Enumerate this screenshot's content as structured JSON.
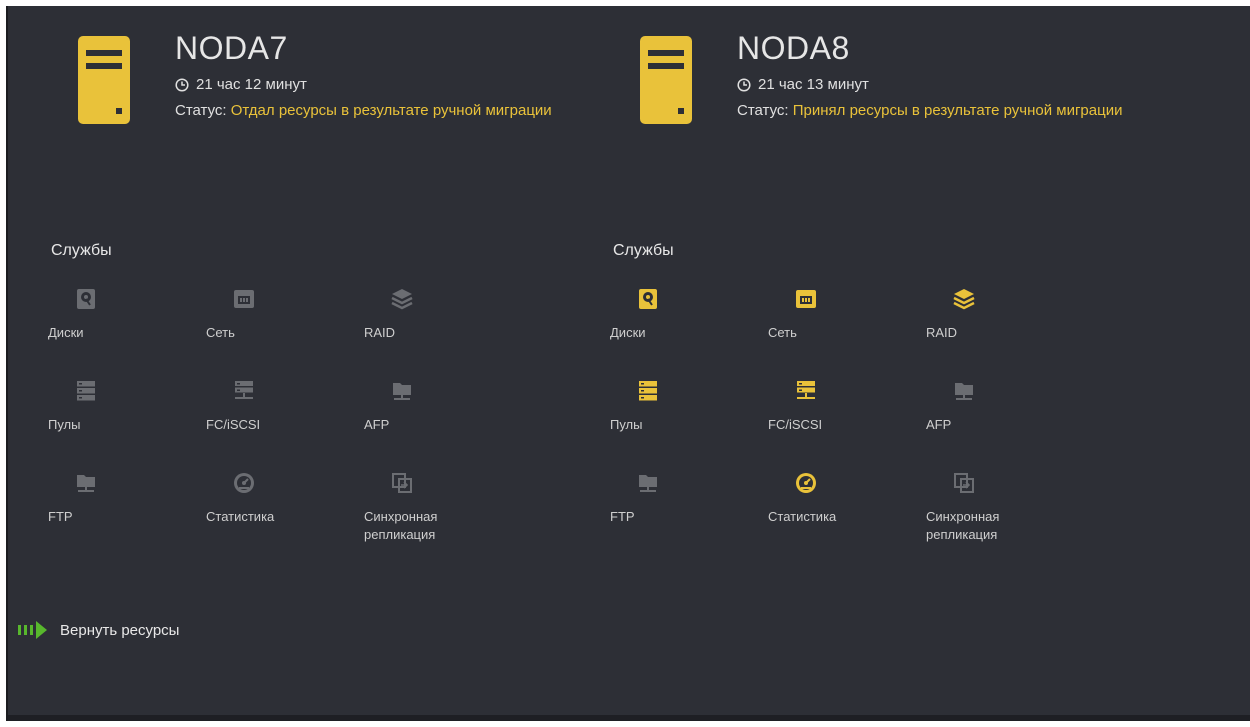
{
  "colors": {
    "accent": "#e9c23a",
    "inactive": "#6b6d72",
    "green": "#58b82d",
    "panel": "#2d2f36"
  },
  "nodes": [
    {
      "title": "NODA7",
      "uptime": "21 час 12 минут",
      "status_label": "Статус:",
      "status_value": "Отдал ресурсы в результате ручной миграции",
      "services_title": "Службы",
      "services": [
        {
          "label": "Диски",
          "icon": "disk-icon",
          "active": false
        },
        {
          "label": "Сеть",
          "icon": "network-icon",
          "active": false
        },
        {
          "label": "RAID",
          "icon": "raid-layers-icon",
          "active": false
        },
        {
          "label": "Пулы",
          "icon": "pools-icon",
          "active": false
        },
        {
          "label": "FC/iSCSI",
          "icon": "fc-iscsi-icon",
          "active": false
        },
        {
          "label": "AFP",
          "icon": "afp-folder-icon",
          "active": false
        },
        {
          "label": "FTP",
          "icon": "ftp-folder-icon",
          "active": false
        },
        {
          "label": "Статистика",
          "icon": "statistics-gauge-icon",
          "active": false
        },
        {
          "label": "Синхронная репликация",
          "icon": "replication-icon",
          "active": false
        }
      ]
    },
    {
      "title": "NODA8",
      "uptime": "21 час 13 минут",
      "status_label": "Статус:",
      "status_value": "Принял ресурсы в результате ручной миграции",
      "services_title": "Службы",
      "services": [
        {
          "label": "Диски",
          "icon": "disk-icon",
          "active": true
        },
        {
          "label": "Сеть",
          "icon": "network-icon",
          "active": true
        },
        {
          "label": "RAID",
          "icon": "raid-layers-icon",
          "active": true
        },
        {
          "label": "Пулы",
          "icon": "pools-icon",
          "active": true
        },
        {
          "label": "FC/iSCSI",
          "icon": "fc-iscsi-icon",
          "active": true
        },
        {
          "label": "AFP",
          "icon": "afp-folder-icon",
          "active": false
        },
        {
          "label": "FTP",
          "icon": "ftp-folder-icon",
          "active": false
        },
        {
          "label": "Статистика",
          "icon": "statistics-gauge-icon",
          "active": true
        },
        {
          "label": "Синхронная репликация",
          "icon": "replication-icon",
          "active": false
        }
      ]
    }
  ],
  "return_button": {
    "label": "Вернуть ресурсы",
    "icon": "arrow-right-icon"
  }
}
